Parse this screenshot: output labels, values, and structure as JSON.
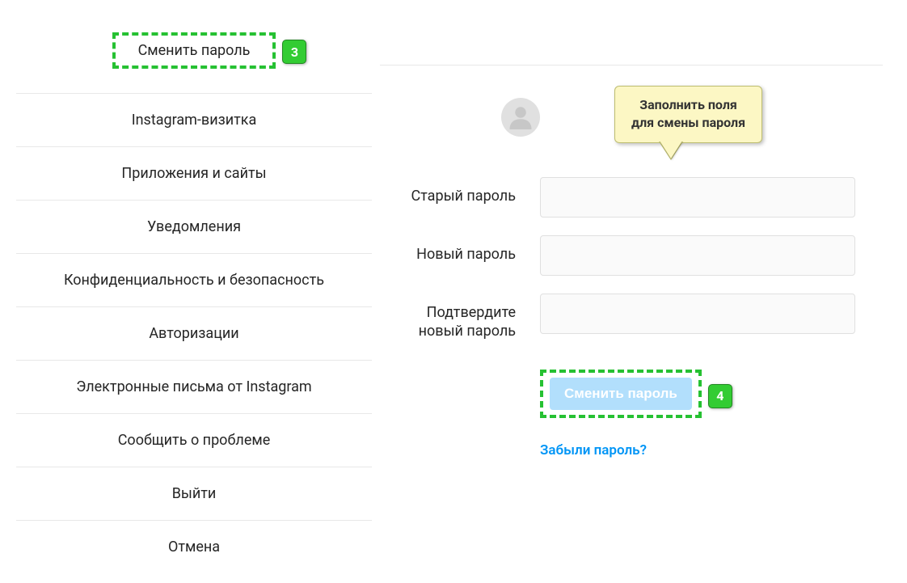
{
  "sidebar": {
    "items": [
      {
        "label": "Сменить пароль"
      },
      {
        "label": "Instagram-визитка"
      },
      {
        "label": "Приложения и сайты"
      },
      {
        "label": "Уведомления"
      },
      {
        "label": "Конфиденциальность и безопасность"
      },
      {
        "label": "Авторизации"
      },
      {
        "label": "Электронные письма от Instagram"
      },
      {
        "label": "Сообщить о проблеме"
      },
      {
        "label": "Выйти"
      },
      {
        "label": "Отмена"
      }
    ]
  },
  "annotations": {
    "step3": "3",
    "step4": "4",
    "tooltip_line1": "Заполнить поля",
    "tooltip_line2": "для смены пароля"
  },
  "form": {
    "old_password_label": "Старый пароль",
    "new_password_label": "Новый пароль",
    "confirm_password_label": "Подтвердите новый пароль",
    "submit_label": "Сменить пароль",
    "forgot_link": "Забыли пароль?"
  }
}
